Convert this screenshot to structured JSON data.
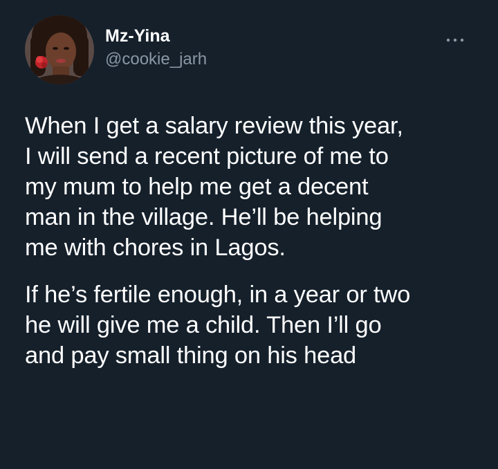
{
  "tweet": {
    "author": {
      "display_name": "Mz-Yina",
      "handle": "@cookie_jarh"
    },
    "more_icon": "more-horizontal-icon",
    "paragraphs": [
      "When I get a salary review this year,\nI will send a recent picture of me to\nmy mum to help me get a decent\nman in the village. He’ll be helping\nme with chores in Lagos.",
      "If he’s fertile enough, in a year or two\nhe will give me a child. Then I’ll go\nand pay small thing on his head"
    ]
  },
  "colors": {
    "background": "#15202b",
    "text_primary": "#ffffff",
    "text_secondary": "#8b98a5"
  }
}
